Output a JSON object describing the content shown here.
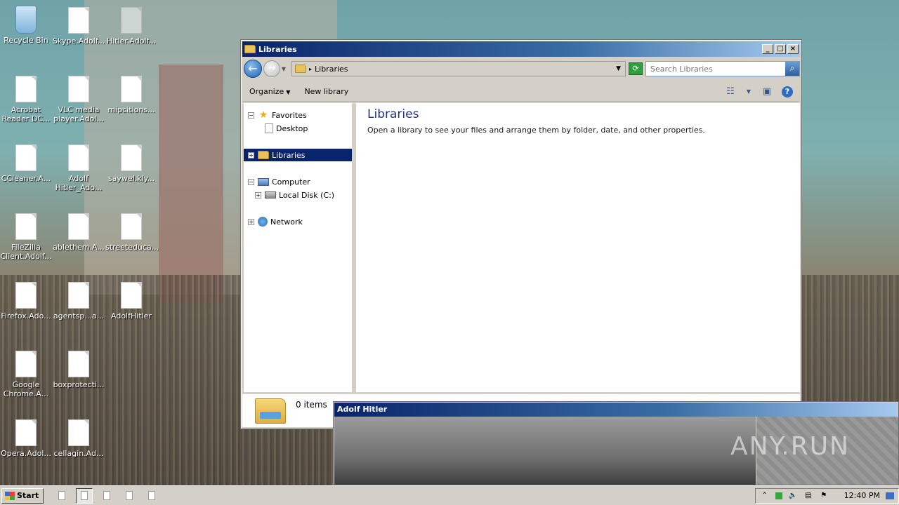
{
  "desktop": {
    "icons": [
      {
        "label": "Recycle Bin"
      },
      {
        "label": "Skype.Adolf..."
      },
      {
        "label": "Hitler.Adolf..."
      },
      {
        "label": "Acrobat Reader DC..."
      },
      {
        "label": "VLC media player.Adol..."
      },
      {
        "label": "mipcitions..."
      },
      {
        "label": "CCleaner.A..."
      },
      {
        "label": "Adolf Hitler_Ado..."
      },
      {
        "label": "saywel.kly..."
      },
      {
        "label": "FileZilla Client.Adolf..."
      },
      {
        "label": "ablethem.A..."
      },
      {
        "label": "streeteduca..."
      },
      {
        "label": "Firefox.Ado..."
      },
      {
        "label": "agentsp...a..."
      },
      {
        "label": "AdolfHitler"
      },
      {
        "label": "Google Chrome.A..."
      },
      {
        "label": "boxprotecti..."
      },
      {
        "label": "Opera.Adol..."
      },
      {
        "label": "cellagin.Ad..."
      }
    ]
  },
  "window": {
    "title": "Libraries",
    "address": "Libraries",
    "search_placeholder": "Search Libraries",
    "toolbar": {
      "organize": "Organize",
      "new_library": "New library"
    },
    "nav": {
      "favorites": "Favorites",
      "desktop": "Desktop",
      "libraries": "Libraries",
      "computer": "Computer",
      "local_disk": "Local Disk (C:)",
      "network": "Network"
    },
    "content": {
      "heading": "Libraries",
      "description": "Open a library to see your files and arrange them by folder, date, and other properties."
    },
    "details": {
      "count": "0 items"
    }
  },
  "popup": {
    "title": "Adolf Hitler"
  },
  "watermark": "ANY.RUN",
  "taskbar": {
    "start": "Start",
    "clock": "12:40 PM"
  }
}
